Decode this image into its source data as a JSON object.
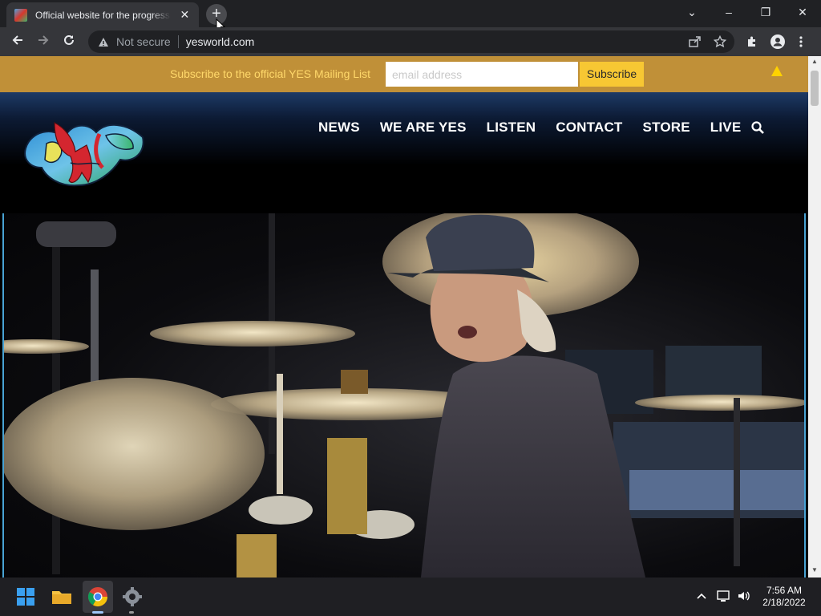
{
  "browser": {
    "tab_title": "Official website for the progressive rock band YES",
    "tab_close": "✕",
    "new_tab": "+",
    "security_label": "Not secure",
    "url": "yesworld.com",
    "window_controls": {
      "minimize": "–",
      "restore": "❐",
      "close": "✕",
      "tab_search": "⌄"
    }
  },
  "mailing": {
    "label": "Subscribe to the official YES Mailing List",
    "email_placeholder": "email address",
    "email_value": "",
    "subscribe_label": "Subscribe"
  },
  "nav": {
    "items": [
      "NEWS",
      "WE ARE YES",
      "LISTEN",
      "CONTACT",
      "STORE",
      "LIVE"
    ]
  },
  "taskbar": {
    "time": "7:56 AM",
    "date": "2/18/2022"
  },
  "colors": {
    "mail_bar": "#c09038",
    "subscribe_button": "#f7c733",
    "header_top": "#1d3a66",
    "accent_border": "#48a3d4"
  }
}
